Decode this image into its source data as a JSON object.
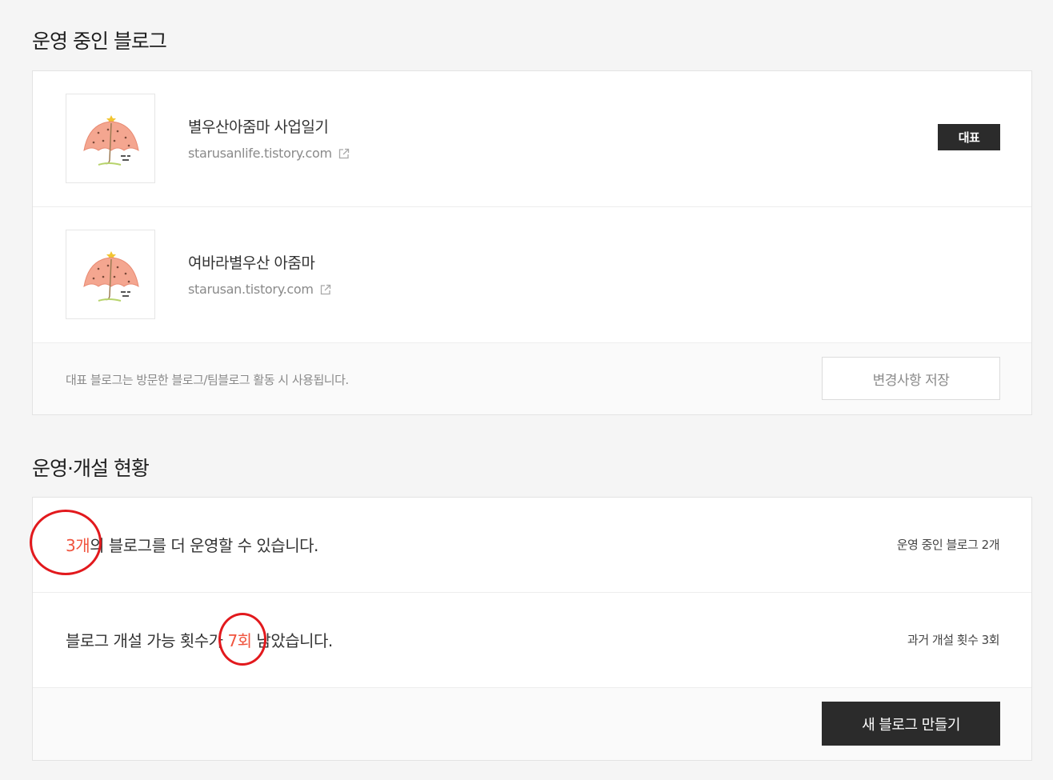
{
  "operating": {
    "title": "운영 중인 블로그",
    "blogs": [
      {
        "name": "별우산아줌마 사업일기",
        "url": "starusanlife.tistory.com",
        "badge": "대표"
      },
      {
        "name": "여바라별우산 아줌마",
        "url": "starusan.tistory.com"
      }
    ],
    "footer_text": "대표 블로그는 방문한 블로그/팀블로그 활동 시 사용됩니다.",
    "save_label": "변경사항 저장"
  },
  "status": {
    "title": "운영·개설 현황",
    "row1": {
      "count": "3개",
      "text": "의 블로그를 더 운영할 수 있습니다.",
      "side": "운영 중인 블로그 2개"
    },
    "row2": {
      "prefix": "블로그 개설 가능 횟수가 ",
      "count": "7회",
      "suffix": " 남았습니다.",
      "side": "과거 개설 횟수 3회"
    },
    "new_blog_label": "새 블로그 만들기"
  },
  "colors": {
    "accent": "#f0543e",
    "annotation": "#e2191d",
    "dark_button": "#2b2b2b"
  },
  "icons": {
    "external_link": "external-link-icon",
    "thumbnail": "umbrella-illustration"
  }
}
